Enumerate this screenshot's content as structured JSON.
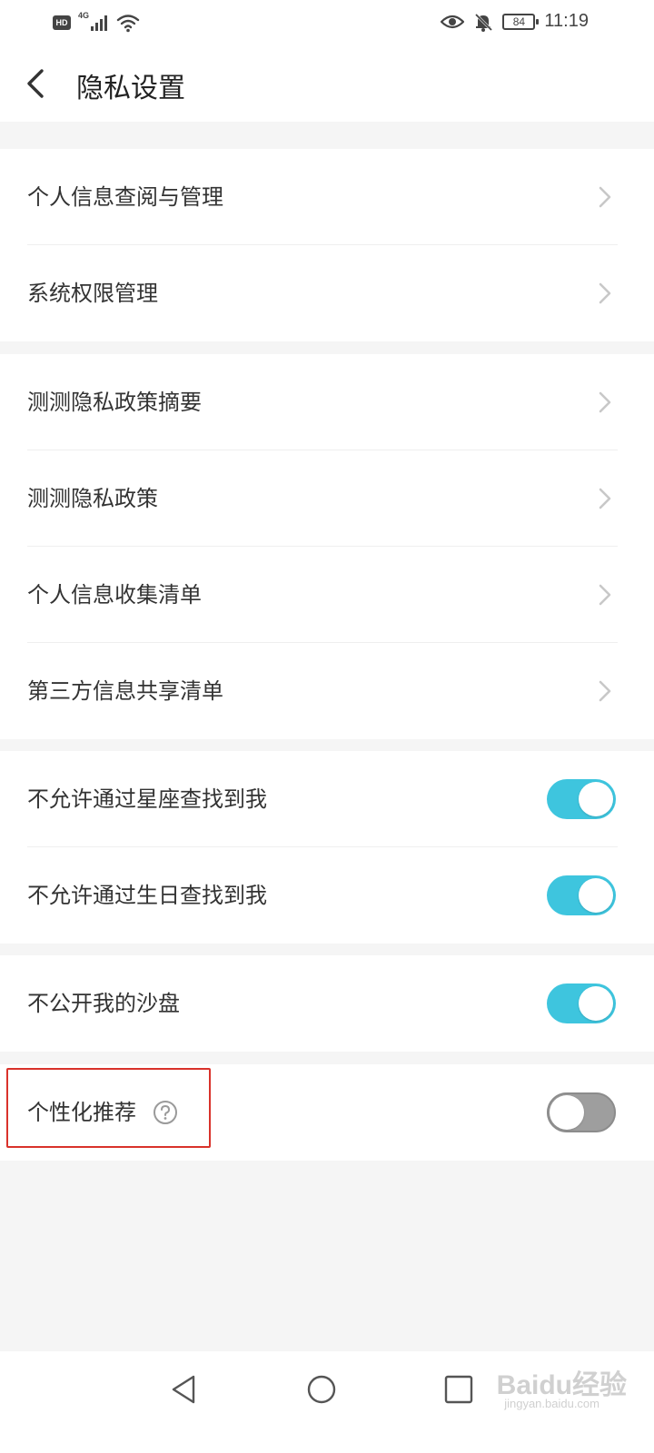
{
  "status_bar": {
    "hd": "HD",
    "network": "4G",
    "battery": "84",
    "time": "11:19"
  },
  "header": {
    "title": "隐私设置"
  },
  "groups": [
    {
      "items": [
        {
          "label": "个人信息查阅与管理",
          "type": "link"
        },
        {
          "label": "系统权限管理",
          "type": "link"
        }
      ]
    },
    {
      "items": [
        {
          "label": "测测隐私政策摘要",
          "type": "link"
        },
        {
          "label": "测测隐私政策",
          "type": "link"
        },
        {
          "label": "个人信息收集清单",
          "type": "link"
        },
        {
          "label": "第三方信息共享清单",
          "type": "link"
        }
      ]
    },
    {
      "items": [
        {
          "label": "不允许通过星座查找到我",
          "type": "toggle",
          "on": true
        },
        {
          "label": "不允许通过生日查找到我",
          "type": "toggle",
          "on": true
        }
      ]
    },
    {
      "items": [
        {
          "label": "不公开我的沙盘",
          "type": "toggle",
          "on": true
        }
      ]
    },
    {
      "items": [
        {
          "label": "个性化推荐",
          "type": "toggle",
          "on": false,
          "help_icon": "question-circle-icon"
        }
      ]
    }
  ],
  "colors": {
    "toggle_on": "#3ec5de",
    "toggle_off": "#9e9e9e",
    "highlight": "#d9322b"
  },
  "watermark": {
    "brand": "Baidu经验",
    "url": "jingyan.baidu.com"
  }
}
